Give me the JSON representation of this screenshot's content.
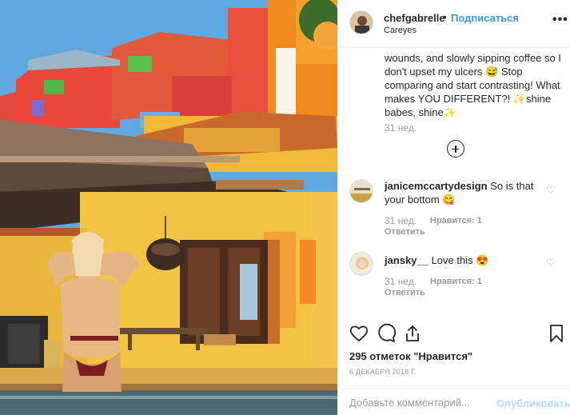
{
  "header": {
    "username": "chefgabrelle",
    "separator": "•",
    "follow_label": "Подписаться",
    "location": "Careyes",
    "more_label": "•••"
  },
  "caption": {
    "text": "wounds, and slowly sipping coffee so I don't upset my ulcers 😅 Stop comparing and start contrasting! What makes YOU DIFFERENT?! ✨shine babes, shine✨",
    "time": "31 нед."
  },
  "comments": [
    {
      "username": "janicemccartydesign",
      "text": "So is that your bottom 😋",
      "time": "31 нед.",
      "likes": "Нравится: 1",
      "reply": "Ответить"
    },
    {
      "username": "jansky__",
      "text": "Love this 😍",
      "time": "31 нед.",
      "likes": "Нравится: 1",
      "reply": "Ответить"
    }
  ],
  "stats": {
    "likes": "295 отметок \"Нравится\"",
    "date": "6 ДЕКАБРЯ 2018 Г."
  },
  "composer": {
    "placeholder": "Добавьте комментарий...",
    "publish_label": "Опубликовать"
  },
  "colors": {
    "accent": "#3897f0",
    "publish_disabled": "#b3dbff",
    "muted": "#999999",
    "text": "#262626"
  }
}
